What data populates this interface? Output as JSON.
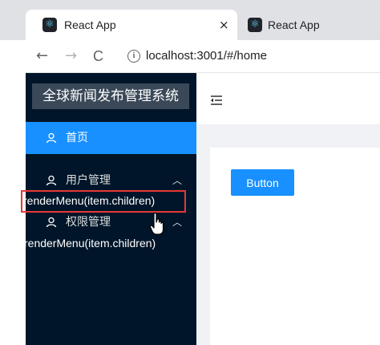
{
  "browser": {
    "tabs": [
      {
        "title": "React App",
        "active": true
      },
      {
        "title": "React App",
        "active": false
      }
    ],
    "tab_close_glyph": "×",
    "url": "localhost:3001/#/home",
    "nav": {
      "back": "←",
      "forward": "→",
      "reload": "C"
    }
  },
  "sidebar": {
    "logo": "全球新闻发布管理系统",
    "items": [
      {
        "label": "首页",
        "selected": true,
        "icon": "user-icon"
      },
      {
        "label": "用户管理",
        "expandable": true,
        "icon": "user-icon"
      },
      {
        "label": "权限管理",
        "expandable": true,
        "icon": "user-icon"
      }
    ],
    "render_labels": [
      "renderMenu(item.children)",
      "renderMenu(item.children)"
    ]
  },
  "header": {
    "fold_icon": "menu-fold-icon"
  },
  "content": {
    "button_label": "Button"
  },
  "colors": {
    "primary": "#1890ff",
    "sider": "#001529",
    "annotation": "#e53935",
    "content_bg": "#f0f2f5"
  }
}
